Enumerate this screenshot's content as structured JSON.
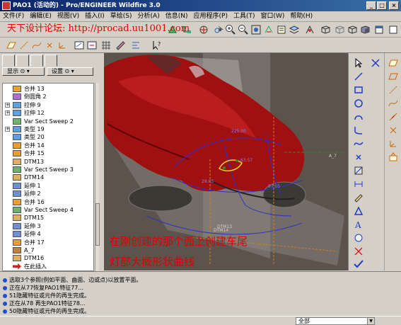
{
  "window": {
    "title": "PAO1 (活动的) - Pro/ENGINEER Wildfire 3.0"
  },
  "watermark": "天下设计论坛: http://procad.uu1001.com",
  "menu": [
    "文件(F)",
    "编辑(E)",
    "视图(V)",
    "插入(I)",
    "草绘(S)",
    "分析(A)",
    "信息(N)",
    "应用程序(P)",
    "工具(T)",
    "窗口(W)",
    "帮助(H)"
  ],
  "leftpanel": {
    "show_label": "显示",
    "settings_label": "设置",
    "tree": [
      {
        "label": "合并 13",
        "icon": "merge-icon",
        "expand": ""
      },
      {
        "label": "倒圆角 2",
        "icon": "round-icon",
        "expand": ""
      },
      {
        "label": "拉伸 9",
        "icon": "extrude-icon",
        "expand": "+"
      },
      {
        "label": "拉伸 12",
        "icon": "extrude-icon",
        "expand": "+"
      },
      {
        "label": "Var Sect Sweep 2",
        "icon": "sweep-icon",
        "expand": ""
      },
      {
        "label": "类型 19",
        "icon": "type-icon",
        "expand": "+"
      },
      {
        "label": "类型 20",
        "icon": "type-icon",
        "expand": ""
      },
      {
        "label": "合并 14",
        "icon": "merge-icon",
        "expand": ""
      },
      {
        "label": "合并 15",
        "icon": "merge-icon",
        "expand": ""
      },
      {
        "label": "DTM13",
        "icon": "datum-plane-icon",
        "expand": ""
      },
      {
        "label": "Var Sect Sweep 3",
        "icon": "sweep-icon",
        "expand": ""
      },
      {
        "label": "DTM14",
        "icon": "datum-plane-icon",
        "expand": ""
      },
      {
        "label": "延伸 1",
        "icon": "extend-icon",
        "expand": ""
      },
      {
        "label": "延伸 2",
        "icon": "extend-icon",
        "expand": ""
      },
      {
        "label": "合并 16",
        "icon": "merge-icon",
        "expand": ""
      },
      {
        "label": "Var Sect Sweep 4",
        "icon": "sweep-icon",
        "expand": ""
      },
      {
        "label": "DTM15",
        "icon": "datum-plane-icon",
        "expand": ""
      },
      {
        "label": "延伸 3",
        "icon": "extend-icon",
        "expand": ""
      },
      {
        "label": "延伸 4",
        "icon": "extend-icon",
        "expand": ""
      },
      {
        "label": "合并 17",
        "icon": "merge-icon",
        "expand": ""
      },
      {
        "label": "A_7",
        "icon": "axis-icon",
        "expand": ""
      },
      {
        "label": "DTM16",
        "icon": "datum-plane-icon",
        "expand": ""
      },
      {
        "label": "在此插入",
        "icon": "insert-here-arrow-icon",
        "expand": ""
      }
    ]
  },
  "viewport": {
    "caption_line1": "在刚创建的那个面上创建车尾",
    "caption_line2": "灯部大概形状曲线",
    "labels": {
      "a7": "A_7",
      "dtm14": "DTM14",
      "dtm13": "DTM13",
      "dim1": "225.00",
      "dim2": "63.57",
      "dim3": "29.05",
      "dim4": "97.05"
    }
  },
  "messages": [
    "选取3个参照(例如平面、曲面、边或点)以放置平面。",
    "正在从77恢复PAO1特征77...",
    "51隐藏特征或元件的再生完成。",
    "正在从78 再生PAO1特征78...",
    "50隐藏特征或元件的再生完成。"
  ],
  "status": {
    "filter_value": "全部"
  },
  "colors": {
    "title_bar": "#0a246a",
    "car_body": "#a01010",
    "viewport_bg": "#5b534c",
    "caption_red": "#e00000",
    "sketch_blue": "#3030c8"
  }
}
